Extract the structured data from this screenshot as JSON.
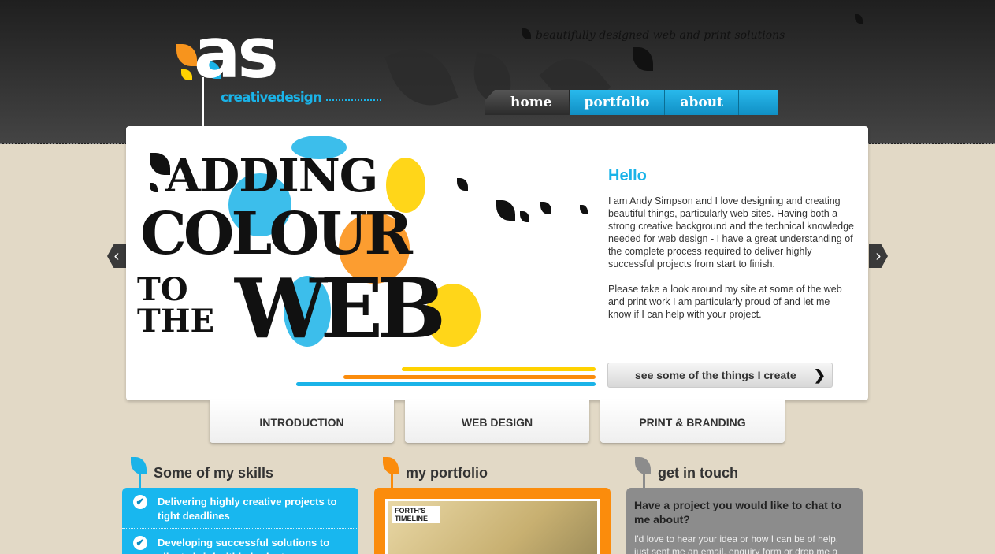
{
  "header": {
    "logo_text": "as",
    "logo_subtitle": "creativedesign",
    "tagline": "beautifully designed web and print solutions"
  },
  "nav": {
    "items": [
      {
        "label": "home"
      },
      {
        "label": "portfolio"
      },
      {
        "label": "about"
      }
    ],
    "active": "home"
  },
  "hero": {
    "headline": {
      "line1": "ADDING",
      "line2": "COLOUR",
      "line3a": "TO",
      "line3b": "THE",
      "line3c": "WEB"
    },
    "hello_title": "Hello",
    "paragraph1": "I am Andy Simpson and I love designing and creating beautiful things, particularly web sites. Having both a strong creative background and the technical knowledge needed for web design - I have a great understanding of the complete process required to deliver highly successful projects from start to finish.",
    "paragraph2": "Please take a look around my site at some of the web and print work I am particularly proud of and let me know if I can help with your project.",
    "cta_label": "see some of the things I create",
    "prev_label": "‹",
    "next_label": "›"
  },
  "tabs": [
    {
      "label": "INTRODUCTION"
    },
    {
      "label": "WEB DESIGN"
    },
    {
      "label": "PRINT & BRANDING"
    }
  ],
  "skills": {
    "title": "Some of my skills",
    "items": [
      {
        "text": "Delivering highly creative projects to tight deadlines"
      },
      {
        "text": "Developing successful solutions to clients brief within budget"
      }
    ]
  },
  "portfolio": {
    "title": "my portfolio",
    "thumb_title": "FORTH'S TIMELINE"
  },
  "contact": {
    "title": "get in touch",
    "heading": "Have a project you would like to chat to me about?",
    "text": "I'd love to hear your idea or how I can be of help, just sent me an email, enquiry form or drop me a"
  },
  "colors": {
    "accent_blue": "#1ab3e8",
    "accent_orange": "#fb8c0c",
    "accent_yellow": "#ffd200",
    "panel_grey": "#8c8c8c",
    "background": "#e2d9c6",
    "header_dark": "#2b2b2b"
  },
  "icons": [
    "leaf-icon",
    "check-icon",
    "chevron-right-icon",
    "chevron-left-icon"
  ]
}
